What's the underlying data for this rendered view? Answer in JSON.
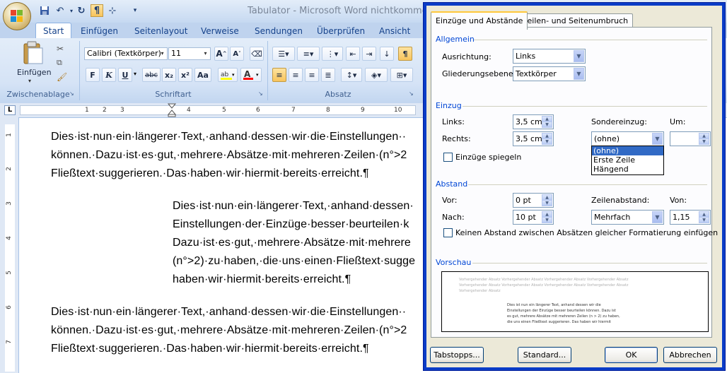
{
  "word": {
    "title": "Tabulator - Microsoft Word nichtkommerzie",
    "tabs": [
      "Start",
      "Einfügen",
      "Seitenlayout",
      "Verweise",
      "Sendungen",
      "Überprüfen",
      "Ansicht"
    ],
    "groups": {
      "clipboard": "Zwischenablage",
      "font": "Schriftart",
      "paragraph": "Absatz"
    },
    "paste_label": "Einfügen",
    "font_name": "Calibri (Textkörper)",
    "font_size": "11",
    "format_buttons": [
      "F",
      "K",
      "U",
      "abc",
      "x₂",
      "x²",
      "Aa"
    ],
    "ruler_numbers": [
      "1",
      "2",
      "3",
      "4",
      "5",
      "6",
      "7",
      "8",
      "9",
      "10"
    ],
    "vruler_numbers": [
      "1",
      "2",
      "3",
      "4",
      "5",
      "6",
      "7"
    ],
    "tab_selector": "L",
    "document": {
      "para1": [
        "Dies·ist·nun·ein·längerer·Text,·anhand·dessen·wir·die·Einstellungen··",
        "können.·Dazu·ist·es·gut,·mehrere·Absätze·mit·mehreren·Zeilen·(n°>2",
        "Fließtext·suggerieren.·Das·haben·wir·hiermit·bereits·erreicht.¶"
      ],
      "para2": [
        "Dies·ist·nun·ein·längerer·Text,·anhand·dessen·",
        "Einstellungen·der·Einzüge·besser·beurteilen·k",
        "Dazu·ist·es·gut,·mehrere·Absätze·mit·mehrere",
        "(n°>2)·zu·haben,·die·uns·einen·Fließtext·sugge",
        "haben·wir·hiermit·bereits·erreicht.¶"
      ],
      "para3": [
        "Dies·ist·nun·ein·längerer·Text,·anhand·dessen·wir·die·Einstellungen··",
        "können.·Dazu·ist·es·gut,·mehrere·Absätze·mit·mehreren·Zeilen·(n°>2",
        "Fließtext·suggerieren.·Das·haben·wir·hiermit·bereits·erreicht.¶"
      ]
    }
  },
  "dialog": {
    "tabs": [
      "Einzüge und Abstände",
      "Zeilen- und Seitenumbruch"
    ],
    "general": {
      "heading": "Allgemein",
      "alignment_label": "Ausrichtung:",
      "alignment_value": "Links",
      "outline_label": "Gliederungsebene:",
      "outline_value": "Textkörper"
    },
    "indent": {
      "heading": "Einzug",
      "left_label": "Links:",
      "left_value": "3,5 cm",
      "right_label": "Rechts:",
      "right_value": "3,5 cm",
      "special_label": "Sondereinzug:",
      "special_value": "(ohne)",
      "by_label": "Um:",
      "by_value": "",
      "mirror_label": "Einzüge spiegeln",
      "special_options": [
        "(ohne)",
        "Erste Zeile",
        "Hängend"
      ]
    },
    "spacing": {
      "heading": "Abstand",
      "before_label": "Vor:",
      "before_value": "0 pt",
      "after_label": "Nach:",
      "after_value": "10 pt",
      "line_label": "Zeilenabstand:",
      "line_value": "Mehrfach",
      "at_label": "Von:",
      "at_value": "1,15",
      "no_space_label": "Keinen Abstand zwischen Absätzen gleicher Formatierung einfügen"
    },
    "preview": {
      "heading": "Vorschau",
      "prev_lines": [
        "Vorhergehender Absatz Vorhergehender Absatz Vorhergehender Absatz Vorhergehender Absatz",
        "Vorhergehender Absatz Vorhergehender Absatz Vorhergehender Absatz Vorhergehender Absatz",
        "Vorhergehender Absatz"
      ],
      "cur_lines": [
        "Dies ist nun ein längerer Text, anhand dessen wir die",
        "Einstellungen der Einzüge besser beurteilen können. Dazu ist",
        "es gut, mehrere Absätze mit mehreren Zeilen (n > 2) zu haben,",
        "die uns einen Fließtext suggerieren. Das haben wir hiermit"
      ]
    },
    "buttons": {
      "tabs": "Tabstopps...",
      "default": "Standard...",
      "ok": "OK",
      "cancel": "Abbrechen"
    }
  }
}
